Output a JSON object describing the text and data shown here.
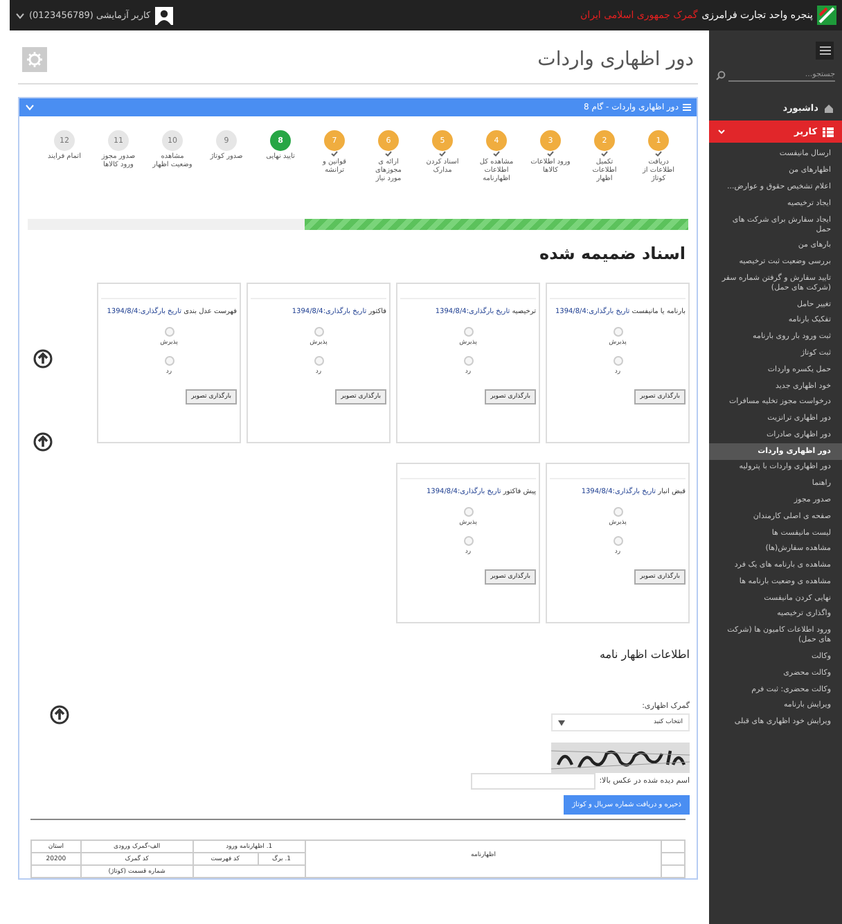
{
  "top_bar": {
    "title": "پنجره واحد تجارت فرامرزی",
    "subtitle": "گمرک جمهوری اسلامی ایران",
    "user": "کاربر آزمایشی (0123456789)"
  },
  "page": {
    "title": "دور اظهاری واردات"
  },
  "panel": {
    "title": "دور اظهاری واردات - گام 8"
  },
  "steps": [
    {
      "number": "1",
      "label": "دریافت اطلاعات از کوتاژ",
      "done": true,
      "current": false
    },
    {
      "number": "2",
      "label": "تکمیل اطلاعات اظهار",
      "done": true,
      "current": false
    },
    {
      "number": "3",
      "label": "ورود اطلاعات کالاها",
      "done": true,
      "current": false
    },
    {
      "number": "4",
      "label": "مشاهده کل اطلاعات اظهارنامه",
      "done": true,
      "current": false
    },
    {
      "number": "5",
      "label": "اسناد کردن مدارک",
      "done": true,
      "current": false
    },
    {
      "number": "6",
      "label": "ارائه ی مجوزهای مورد نیاز",
      "done": true,
      "current": false
    },
    {
      "number": "7",
      "label": "قوانین و ترانشه",
      "done": true,
      "current": false
    },
    {
      "number": "8",
      "label": "تایید نهایی",
      "done": false,
      "current": true
    },
    {
      "number": "9",
      "label": "صدور کوتاژ",
      "done": false,
      "current": false
    },
    {
      "number": "10",
      "label": "مشاهده وضعیت اظهار",
      "done": false,
      "current": false
    },
    {
      "number": "11",
      "label": "صدور مجوز ورود کالاها",
      "done": false,
      "current": false
    },
    {
      "number": "12",
      "label": "اتمام فرایند",
      "done": false,
      "current": false
    }
  ],
  "progress": {
    "level": 0.58
  },
  "attachments": {
    "title": "اسناد ضمیمه شده",
    "cards": [
      {
        "title": "بارنامه یا مانیفست",
        "date": "تاریخ بارگذاری:1394/8/4",
        "options": [
          {
            "label": "پذیرش",
            "selected": false
          },
          {
            "label": "رد",
            "selected": false
          }
        ],
        "button": "بارگذاری تصویر"
      },
      {
        "title": "ترخیصیه",
        "date": "تاریخ بارگذاری:1394/8/4",
        "options": [
          {
            "label": "پذیرش",
            "selected": false
          },
          {
            "label": "رد",
            "selected": false
          }
        ],
        "button": "بارگذاری تصویر"
      },
      {
        "title": "فاکتور",
        "date": "تاریخ بارگذاری:1394/8/4",
        "options": [
          {
            "label": "پذیرش",
            "selected": false
          },
          {
            "label": "رد",
            "selected": false
          }
        ],
        "button": "بارگذاری تصویر"
      },
      {
        "title": "فهرست عدل بندی",
        "date": "تاریخ بارگذاری:1394/8/4",
        "options": [
          {
            "label": "پذیرش",
            "selected": false
          },
          {
            "label": "رد",
            "selected": false
          }
        ],
        "button": "بارگذاری تصویر"
      },
      {
        "title": "قبض انبار",
        "date": "تاریخ بارگذاری:1394/8/4",
        "options": [
          {
            "label": "پذیرش",
            "selected": false
          },
          {
            "label": "رد",
            "selected": false
          }
        ],
        "button": "بارگذاری تصویر"
      },
      {
        "title": "پیش فاکتور",
        "date": "تاریخ بارگذاری:1394/8/4",
        "options": [
          {
            "label": "پذیرش",
            "selected": false
          },
          {
            "label": "رد",
            "selected": false
          }
        ],
        "button": "بارگذاری تصویر"
      }
    ]
  },
  "declaration": {
    "title": "اطلاعات اظهار نامه",
    "customs_label": "گمرک اظهاری:",
    "customs_select": "انتخاب کنید",
    "captcha_label": "اسم دیده شده در عکس بالا:",
    "submit": "ذخیره و دریافت شماره سریال و کوتاژ"
  },
  "form_table": {
    "rows": [
      [
        {
          "text": "اظهارنامه",
          "rowspan": 3
        },
        {
          "text": "1. اظهارنامه ورود",
          "colspan": 2
        },
        {
          "text": "الف-گمرک ورودی"
        },
        {
          "text": "استان"
        }
      ],
      [
        {
          "text": "1. برگ"
        },
        {
          "text": "کد فهرست"
        },
        {
          "text": "کد گمرک"
        },
        {
          "text": "20200"
        }
      ],
      [
        {
          "colspan": 2
        },
        {
          "text": "شماره قسمت (کوتاژ)"
        },
        {}
      ]
    ]
  },
  "sidebar": {
    "search_placeholder": "جستجو...",
    "dashboard": "داشبورد",
    "group": {
      "label": "کاربر",
      "expanded": true
    },
    "items": [
      {
        "label": "ارسال مانیفست",
        "selected": false
      },
      {
        "label": "اظهارهای من",
        "selected": false
      },
      {
        "label": "اعلام تشخیص حقوق و عوارض...",
        "selected": false
      },
      {
        "label": "ایجاد ترخیصیه",
        "selected": false
      },
      {
        "label": "ایجاد سفارش برای شرکت های حمل",
        "selected": false
      },
      {
        "label": "بارهای من",
        "selected": false
      },
      {
        "label": "بررسی وضعیت ثبت ترخیصیه",
        "selected": false
      },
      {
        "label": "تایید سفارش و گرفتن شماره سفر (شرکت های حمل)",
        "selected": false
      },
      {
        "label": "تغییر حامل",
        "selected": false
      },
      {
        "label": "تفکیک بارنامه",
        "selected": false
      },
      {
        "label": "ثبت ورود بار روی بارنامه",
        "selected": false
      },
      {
        "label": "ثبت کوتاژ",
        "selected": false
      },
      {
        "label": "حمل یکسره واردات",
        "selected": false
      },
      {
        "label": "خود اظهاری جدید",
        "selected": false
      },
      {
        "label": "درخواست مجوز تخلیه مسافرات",
        "selected": false
      },
      {
        "label": "دور اظهاری ترانزیت",
        "selected": false
      },
      {
        "label": "دور اظهاری صادرات",
        "selected": false
      },
      {
        "label": "دور اظهاری واردات",
        "selected": true
      },
      {
        "label": "دور اظهاری واردات با پترولیه",
        "selected": false
      },
      {
        "label": "راهنما",
        "selected": false
      },
      {
        "label": "صدور مجوز",
        "selected": false
      },
      {
        "label": "صفحه ی اصلی کارمندان",
        "selected": false
      },
      {
        "label": "لیست مانیفست ها",
        "selected": false
      },
      {
        "label": "مشاهده سفارش(ها)",
        "selected": false
      },
      {
        "label": "مشاهده ی بارنامه های یک فرد",
        "selected": false
      },
      {
        "label": "مشاهده ی وضعیت بارنامه ها",
        "selected": false
      },
      {
        "label": "نهایی کردن مانیفست",
        "selected": false
      },
      {
        "label": "واگذاری ترخیصیه",
        "selected": false
      },
      {
        "label": "ورود اطلاعات کامیون ها (شرکت های حمل)",
        "selected": false
      },
      {
        "label": "وکالت",
        "selected": false
      },
      {
        "label": "وکالت محضری",
        "selected": false
      },
      {
        "label": "وکالت محضری: ثبت فرم",
        "selected": false
      },
      {
        "label": "ویرایش بارنامه",
        "selected": false
      },
      {
        "label": "ویرایش خود اظهاری های قبلی",
        "selected": false
      }
    ]
  }
}
